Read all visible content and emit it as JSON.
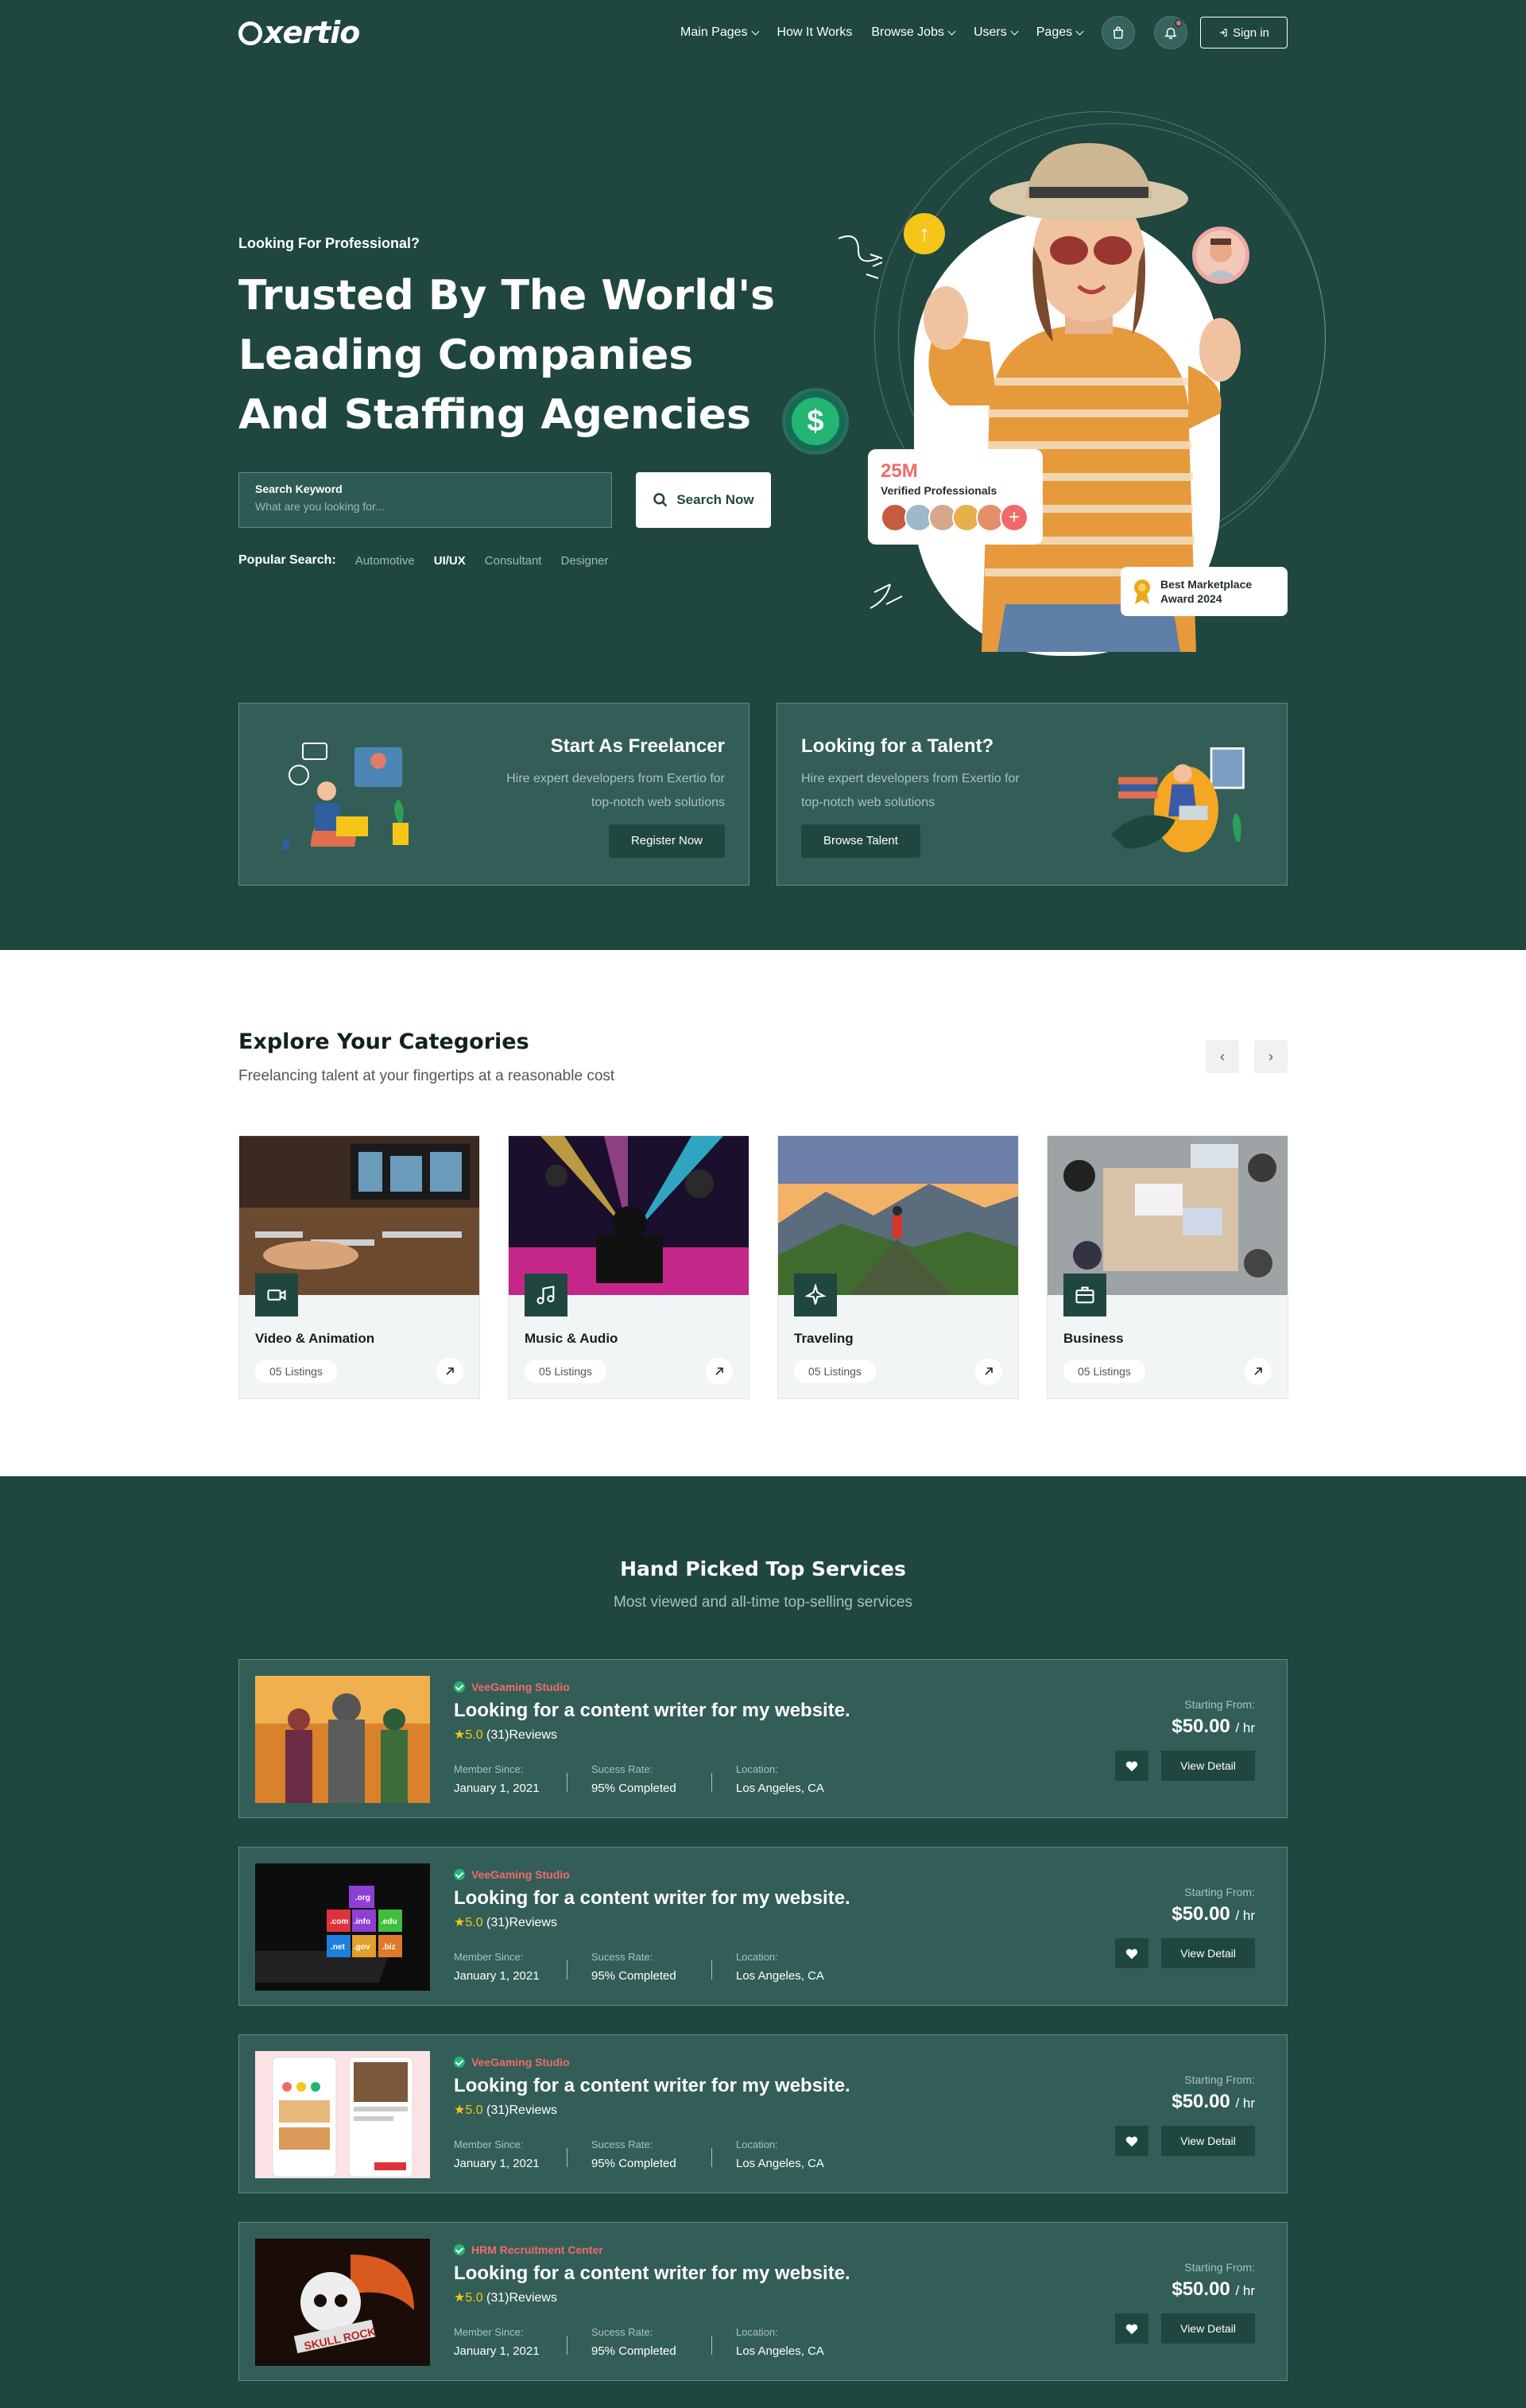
{
  "brand": {
    "logo_text": "xertio"
  },
  "nav": {
    "items": [
      {
        "label": "Main Pages",
        "dropdown": true
      },
      {
        "label": "How It Works",
        "dropdown": false
      },
      {
        "label": "Browse Jobs",
        "dropdown": true
      },
      {
        "label": "Users",
        "dropdown": true
      },
      {
        "label": "Pages",
        "dropdown": true
      }
    ],
    "signin_label": "Sign in"
  },
  "hero": {
    "eyebrow": "Looking For Professional?",
    "title": "Trusted By The World's Leading Companies And Staffing Agencies",
    "search_label": "Search Keyword",
    "search_placeholder": "What are you looking for...",
    "search_button": "Search Now",
    "popular_label": "Popular Search:",
    "popular": [
      {
        "label": "Automotive",
        "active": false
      },
      {
        "label": "UI/UX",
        "active": true
      },
      {
        "label": "Consultant",
        "active": false
      },
      {
        "label": "Designer",
        "active": false
      }
    ],
    "stat_number": "25M",
    "stat_label": "Verified Professionals",
    "award_line1": "Best Marketplace",
    "award_line2": "Award 2024"
  },
  "promos": {
    "freelancer": {
      "title": "Start As Freelancer",
      "desc_line1": "Hire expert developers from Exertio for",
      "desc_line2": "top-notch web solutions",
      "button": "Register Now"
    },
    "talent": {
      "title": "Looking for a Talent?",
      "desc_line1": "Hire expert developers from Exertio for",
      "desc_line2": "top-notch web solutions",
      "button": "Browse Talent"
    }
  },
  "categories": {
    "title": "Explore Your Categories",
    "subtitle": "Freelancing talent at your fingertips at a reasonable cost",
    "items": [
      {
        "name": "Video & Animation",
        "count": "05 Listings",
        "icon": "video-icon"
      },
      {
        "name": "Music & Audio",
        "count": "05 Listings",
        "icon": "music-icon"
      },
      {
        "name": "Traveling",
        "count": "05 Listings",
        "icon": "plane-icon"
      },
      {
        "name": "Business",
        "count": "05 Listings",
        "icon": "briefcase-icon"
      }
    ]
  },
  "services": {
    "title": "Hand Picked Top Services",
    "subtitle": "Most viewed and all-time top-selling services",
    "member_since_label": "Member Since:",
    "success_label": "Sucess Rate:",
    "location_label": "Location:",
    "price_label": "Starting From:",
    "detail_label": "View Detail",
    "items": [
      {
        "studio": "VeeGaming Studio",
        "title": "Looking for a content writer for my website.",
        "rating": "5.0",
        "reviews": "(31)Reviews",
        "member_since": "January 1, 2021",
        "success": "95% Completed",
        "location": "Los Angeles, CA",
        "price": "$50.00",
        "unit": "/ hr"
      },
      {
        "studio": "VeeGaming Studio",
        "title": "Looking for a content writer for my website.",
        "rating": "5.0",
        "reviews": "(31)Reviews",
        "member_since": "January 1, 2021",
        "success": "95% Completed",
        "location": "Los Angeles, CA",
        "price": "$50.00",
        "unit": "/ hr"
      },
      {
        "studio": "VeeGaming Studio",
        "title": "Looking for a content writer for my website.",
        "rating": "5.0",
        "reviews": "(31)Reviews",
        "member_since": "January 1, 2021",
        "success": "95% Completed",
        "location": "Los Angeles, CA",
        "price": "$50.00",
        "unit": "/ hr"
      },
      {
        "studio": "HRM Recruitment Center",
        "title": "Looking for a content writer for my website.",
        "rating": "5.0",
        "reviews": "(31)Reviews",
        "member_since": "January 1, 2021",
        "success": "95% Completed",
        "location": "Los Angeles, CA",
        "price": "$50.00",
        "unit": "/ hr"
      }
    ]
  },
  "thumb_text": {
    "domains": [
      ".org",
      ".com",
      ".info",
      ".edu",
      ".net",
      ".gov",
      ".biz"
    ],
    "skull_logo": "SKULL ROCK"
  },
  "colors": {
    "primary": "#1f4740",
    "card": "#335e57",
    "accent": "#f16a6a",
    "star": "#f5c518",
    "success": "#22b573"
  }
}
